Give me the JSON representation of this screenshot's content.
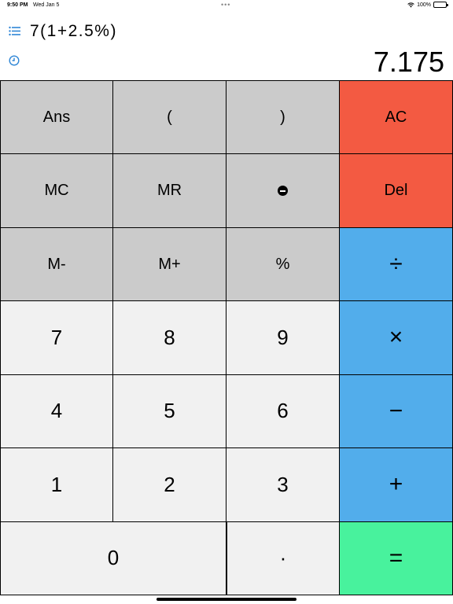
{
  "status_bar": {
    "time": "9:50 PM",
    "date": "Wed Jan 5",
    "dots": "•••",
    "battery": "100%"
  },
  "display": {
    "expression": "7(1+2.5%)",
    "result": "7.175"
  },
  "keys": {
    "ans": "Ans",
    "open_paren": "(",
    "close_paren": ")",
    "ac": "AC",
    "mc": "MC",
    "mr": "MR",
    "del": "Del",
    "m_minus": "M-",
    "m_plus": "M+",
    "percent": "%",
    "divide": "÷",
    "seven": "7",
    "eight": "8",
    "nine": "9",
    "multiply": "×",
    "four": "4",
    "five": "5",
    "six": "6",
    "minus": "−",
    "one": "1",
    "two": "2",
    "three": "3",
    "plus": "+",
    "zero": "0",
    "dot": "·",
    "equals": "="
  },
  "icons": {
    "history": "list-icon",
    "clock": "clock-icon",
    "negate": "negate-icon",
    "wifi": "wifi-icon",
    "battery": "battery-icon"
  },
  "colors": {
    "function_key": "#cbcbcb",
    "number_key": "#f1f1f1",
    "clear_key": "#f35a42",
    "operator_key": "#52adeb",
    "equals_key": "#48f29d",
    "accent": "#2f86d6"
  }
}
